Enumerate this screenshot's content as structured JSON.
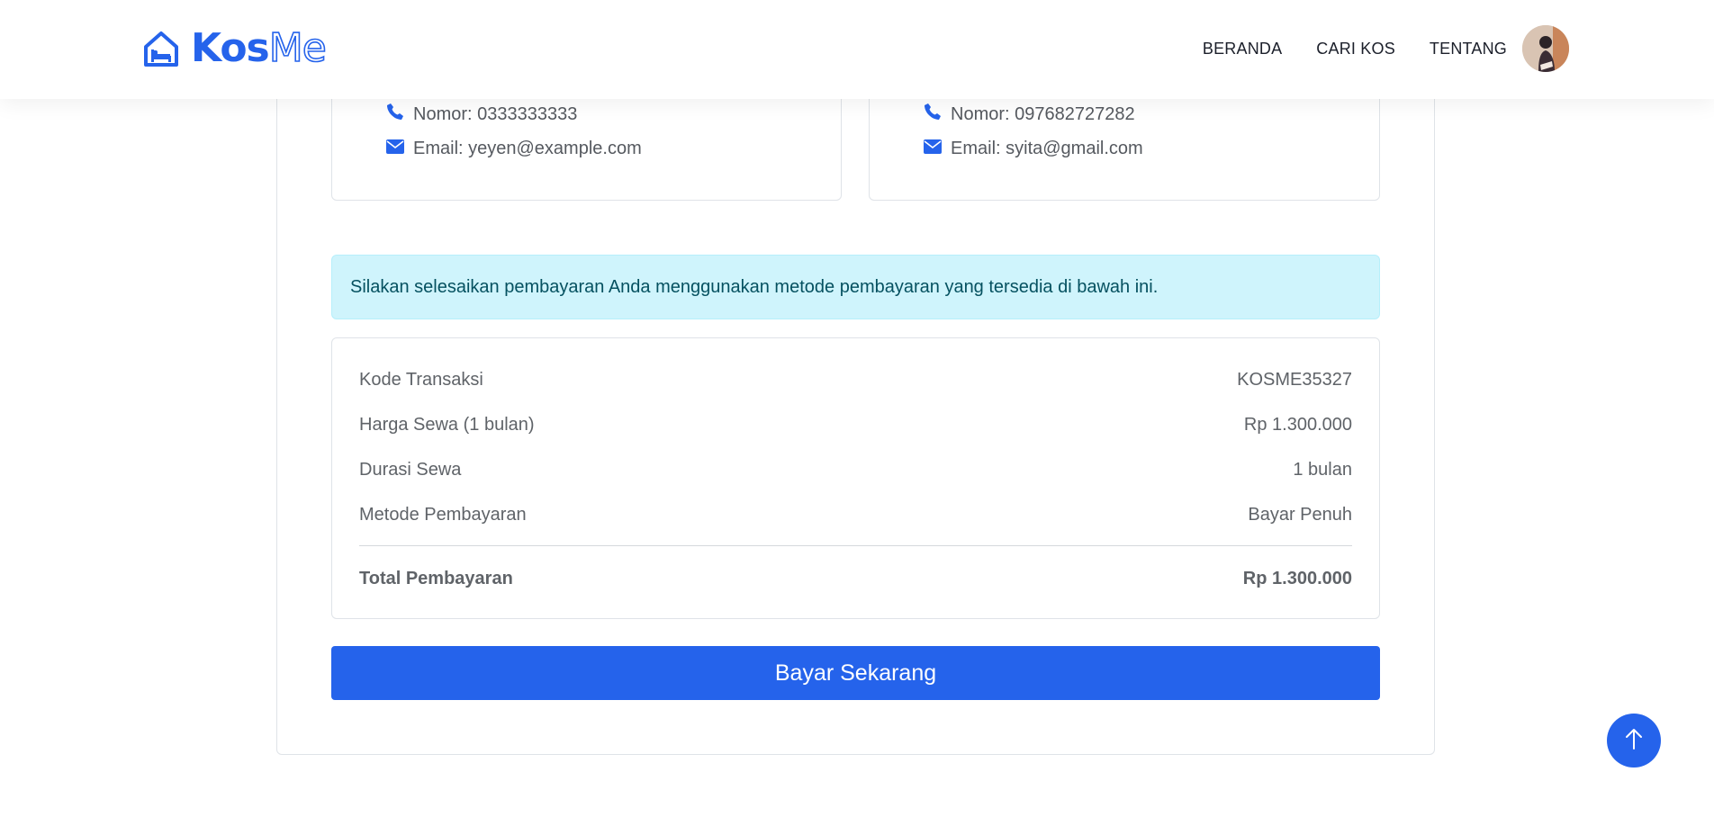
{
  "brand": {
    "logo_icon": "house-bed-icon",
    "name_part1": "Kos",
    "name_part2": "Me",
    "color": "#2563eb"
  },
  "nav": {
    "links": [
      "BERANDA",
      "CARI KOS",
      "TENTANG"
    ],
    "avatar_icon": "user-avatar"
  },
  "contacts": [
    {
      "phone_label": "Nomor: 0333333333",
      "email_label": "Email: yeyen@example.com"
    },
    {
      "phone_label": "Nomor: 097682727282",
      "email_label": "Email: syita@gmail.com"
    }
  ],
  "alert": {
    "text": "Silakan selesaikan pembayaran Anda menggunakan metode pembayaran yang tersedia di bawah ini.",
    "bg_color": "#cff4fc"
  },
  "summary": {
    "rows": [
      {
        "label": "Kode Transaksi",
        "value": "KOSME35327"
      },
      {
        "label": "Harga Sewa (1 bulan)",
        "value": "Rp 1.300.000"
      },
      {
        "label": "Durasi Sewa",
        "value": "1 bulan"
      },
      {
        "label": "Metode Pembayaran",
        "value": "Bayar Penuh"
      }
    ],
    "total": {
      "label": "Total Pembayaran",
      "value": "Rp 1.300.000"
    }
  },
  "pay_button": {
    "label": "Bayar Sekarang",
    "color": "#2563eb"
  },
  "scroll_top": {
    "icon": "arrow-up-icon"
  }
}
